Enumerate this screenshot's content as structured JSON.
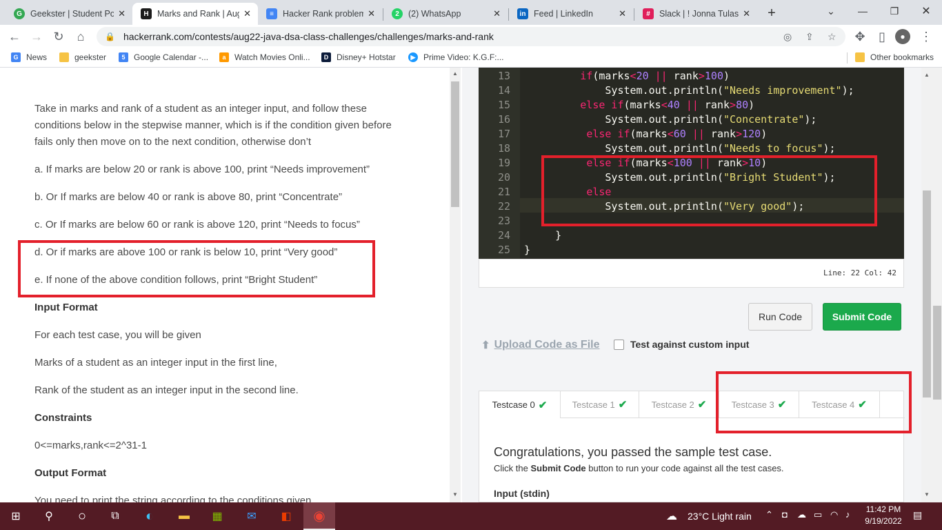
{
  "browser": {
    "tabs": [
      {
        "title": "Geekster | Student Por",
        "icon_color": "#34a853",
        "icon": "G"
      },
      {
        "title": "Marks and Rank | Aug",
        "icon_color": "#1c1c1c",
        "icon": "H"
      },
      {
        "title": "Hacker Rank problem",
        "icon_color": "#4285f4",
        "icon": "≡"
      },
      {
        "title": "(2) WhatsApp",
        "icon_color": "#25d366",
        "icon": "2"
      },
      {
        "title": "Feed | LinkedIn",
        "icon_color": "#0a66c2",
        "icon": "in"
      },
      {
        "title": "Slack | ! Jonna Tulasi D",
        "icon_color": "#e01e5a",
        "icon": "#"
      }
    ],
    "new_tab": "+",
    "url": "hackerrank.com/contests/aug22-java-dsa-class-challenges/challenges/marks-and-rank",
    "bookmarks": [
      {
        "label": "News",
        "icon_color": "#4285f4",
        "icon": "G"
      },
      {
        "label": "geekster",
        "icon_color": "#f6c344",
        "icon": ""
      },
      {
        "label": "Google Calendar -...",
        "icon_color": "#4285f4",
        "icon": "5"
      },
      {
        "label": "Watch Movies Onli...",
        "icon_color": "#ff9900",
        "icon": "a"
      },
      {
        "label": "Disney+ Hotstar",
        "icon_color": "#0c1b3a",
        "icon": "D"
      },
      {
        "label": "Prime Video: K.G.F:...",
        "icon_color": "#1a98ff",
        "icon": "▶"
      }
    ],
    "other_bookmarks": "Other bookmarks"
  },
  "problem": {
    "intro": "Take in marks and rank of a student as an integer input, and follow these conditions below in the stepwise manner, which is if the condition given before fails only then move on to the next condition, otherwise don’t",
    "cond_a": "a. If marks are below 20 or rank is above 100, print “Needs improvement”",
    "cond_b": "b. Or If marks are below 40 or rank is above 80, print “Concentrate”",
    "cond_c": "c. Or If marks are below 60 or rank is above 120, print “Needs to focus”",
    "cond_d": "d. Or if marks are above 100 or rank is below 10, print “Very good”",
    "cond_e": "e. If none of the above condition follows, print “Bright Student”",
    "input_format_h": "Input Format",
    "input_1": "For each test case, you will be given",
    "input_2": "Marks of a student as an integer input in the first line,",
    "input_3": "Rank of the student as an integer input in the second line.",
    "constraints_h": "Constraints",
    "constraints": "0<=marks,rank<=2^31-1",
    "output_format_h": "Output Format",
    "output_1": "You need to print the string according to the conditions given"
  },
  "editor": {
    "line_numbers": [
      "13",
      "14",
      "15",
      "16",
      "17",
      "18",
      "19",
      "20",
      "21",
      "22",
      "23",
      "24",
      "25"
    ],
    "status": "Line: 22 Col: 42"
  },
  "actions": {
    "run": "Run Code",
    "submit": "Submit Code",
    "upload": "Upload Code as File",
    "custom_input": "Test against custom input"
  },
  "testcases": [
    "Testcase 0",
    "Testcase 1",
    "Testcase 2",
    "Testcase 3",
    "Testcase 4"
  ],
  "result": {
    "title": "Congratulations, you passed the sample test case.",
    "desc_pre": "Click the ",
    "desc_bold": "Submit Code",
    "desc_post": " button to run your code against all the test cases.",
    "input_label": "Input (stdin)"
  },
  "taskbar": {
    "weather": "23°C  Light rain",
    "time": "11:42 PM",
    "date": "9/19/2022"
  },
  "colors": {
    "annotation": "#e3202b",
    "submit": "#1ba94c",
    "taskbar": "#531b24"
  }
}
